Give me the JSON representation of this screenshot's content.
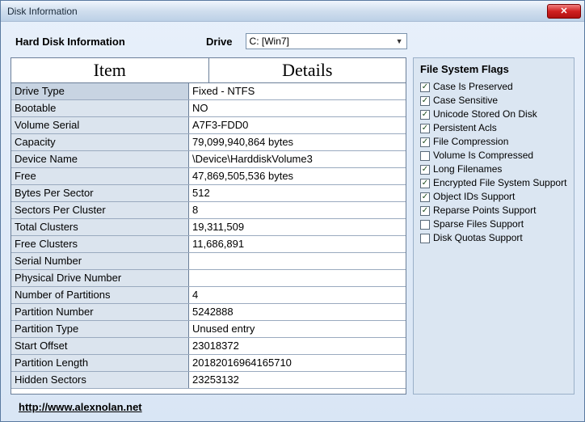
{
  "window": {
    "title": "Disk Information"
  },
  "header": {
    "hdi_label": "Hard Disk Information",
    "drive_label": "Drive",
    "drive_selected": "C: [Win7]"
  },
  "table": {
    "col_item": "Item",
    "col_details": "Details",
    "rows": [
      {
        "item": "Drive Type",
        "details": "Fixed - NTFS"
      },
      {
        "item": "Bootable",
        "details": "NO"
      },
      {
        "item": "Volume Serial",
        "details": "A7F3-FDD0"
      },
      {
        "item": "Capacity",
        "details": "79,099,940,864 bytes"
      },
      {
        "item": "Device Name",
        "details": "\\Device\\HarddiskVolume3"
      },
      {
        "item": "Free",
        "details": "47,869,505,536 bytes"
      },
      {
        "item": "Bytes Per Sector",
        "details": "512"
      },
      {
        "item": "Sectors Per Cluster",
        "details": "8"
      },
      {
        "item": "Total Clusters",
        "details": "19,311,509"
      },
      {
        "item": "Free Clusters",
        "details": "11,686,891"
      },
      {
        "item": "Serial Number",
        "details": ""
      },
      {
        "item": "Physical Drive Number",
        "details": ""
      },
      {
        "item": "Number of Partitions",
        "details": "4"
      },
      {
        "item": "Partition Number",
        "details": "5242888"
      },
      {
        "item": "Partition Type",
        "details": "Unused entry"
      },
      {
        "item": "Start Offset",
        "details": "23018372"
      },
      {
        "item": "Partition Length",
        "details": "20182016964165710"
      },
      {
        "item": "Hidden Sectors",
        "details": "23253132"
      }
    ]
  },
  "flags": {
    "title": "File System Flags",
    "items": [
      {
        "label": "Case Is Preserved",
        "checked": true
      },
      {
        "label": "Case Sensitive",
        "checked": true
      },
      {
        "label": "Unicode Stored On Disk",
        "checked": true
      },
      {
        "label": "Persistent Acls",
        "checked": true
      },
      {
        "label": "File Compression",
        "checked": true
      },
      {
        "label": "Volume Is Compressed",
        "checked": false
      },
      {
        "label": "Long Filenames",
        "checked": true
      },
      {
        "label": "Encrypted File System Support",
        "checked": true
      },
      {
        "label": "Object IDs Support",
        "checked": true
      },
      {
        "label": "Reparse Points Support",
        "checked": true
      },
      {
        "label": "Sparse Files Support",
        "checked": false
      },
      {
        "label": "Disk Quotas Support",
        "checked": false
      }
    ]
  },
  "footer": {
    "link_text": "http://www.alexnolan.net"
  }
}
